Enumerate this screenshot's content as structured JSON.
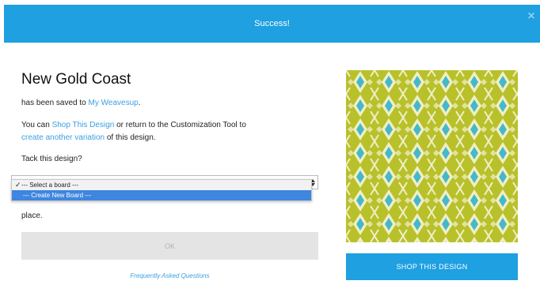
{
  "header": {
    "title": "Success!",
    "close_icon": "close-icon"
  },
  "design": {
    "name": "New Gold Coast",
    "saved_prefix": "has been saved to ",
    "saved_link": "My Weavesup",
    "saved_suffix": ".",
    "you_can_prefix": "You can ",
    "shop_link": "Shop This Design",
    "you_can_middle": " or return to the Customization Tool to",
    "variation_link": "create another variation",
    "variation_suffix": " of this design."
  },
  "tack": {
    "question": "Tack this design?",
    "options": [
      "--- Select a board ---",
      "--- Create New Board ---"
    ],
    "selected_index": 0,
    "highlighted_index": 1,
    "trailing_text": "place."
  },
  "buttons": {
    "ok": "OK",
    "shop": "SHOP THIS DESIGN"
  },
  "faq_link": "Frequently Asked Questions",
  "colors": {
    "accent": "#1ea0e1",
    "pattern_lime": "#b8c12a",
    "pattern_teal": "#46b8c8",
    "pattern_cream": "#f0efc6"
  }
}
